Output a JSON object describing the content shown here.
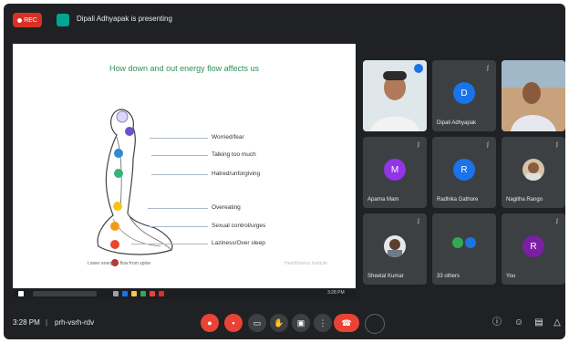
{
  "header": {
    "rec_label": "REC",
    "presenting_text": "Dipali Adhyapak is presenting"
  },
  "slide": {
    "title": "How down and out energy flow affects us",
    "points": [
      "Worried/fear",
      "Talking too much",
      "Hatred/unforgiving",
      "Overeating",
      "Sexual control/urges",
      "Laziness/Over sleep"
    ],
    "caption": "Lower energies flow from spine",
    "watermark": "Heartfulness Institute"
  },
  "participants": [
    {
      "name": "",
      "initial": "",
      "color": "#c9d4d6",
      "video": true
    },
    {
      "name": "Dipali Adhyapak",
      "initial": "D",
      "color": "#1a73e8",
      "video": false
    },
    {
      "name": "",
      "initial": "",
      "color": "#b48a6a",
      "video": true
    },
    {
      "name": "Aparna Mam",
      "initial": "M",
      "color": "#9334e6",
      "video": false
    },
    {
      "name": "Radhika Gathore",
      "initial": "R",
      "color": "#1a73e8",
      "video": false
    },
    {
      "name": "Nagitha Rango",
      "initial": "",
      "color": "#8a6d54",
      "video": true
    },
    {
      "name": "Sheetal Kumar",
      "initial": "",
      "color": "#6b6b6b",
      "video": true
    },
    {
      "name": "33 others",
      "initial": "",
      "color": "#1a73e8",
      "video": false
    },
    {
      "name": "You",
      "initial": "R",
      "color": "#7b1fa2",
      "video": false
    }
  ],
  "bottom": {
    "time": "3:28 PM",
    "separator": "|",
    "meeting_code": "prh-vsrh-rdv"
  },
  "taskbar": {
    "time": "3:28 PM"
  },
  "colors": {
    "background": "#202124",
    "control_red": "#ea4335",
    "control_gray": "#3c4043"
  }
}
